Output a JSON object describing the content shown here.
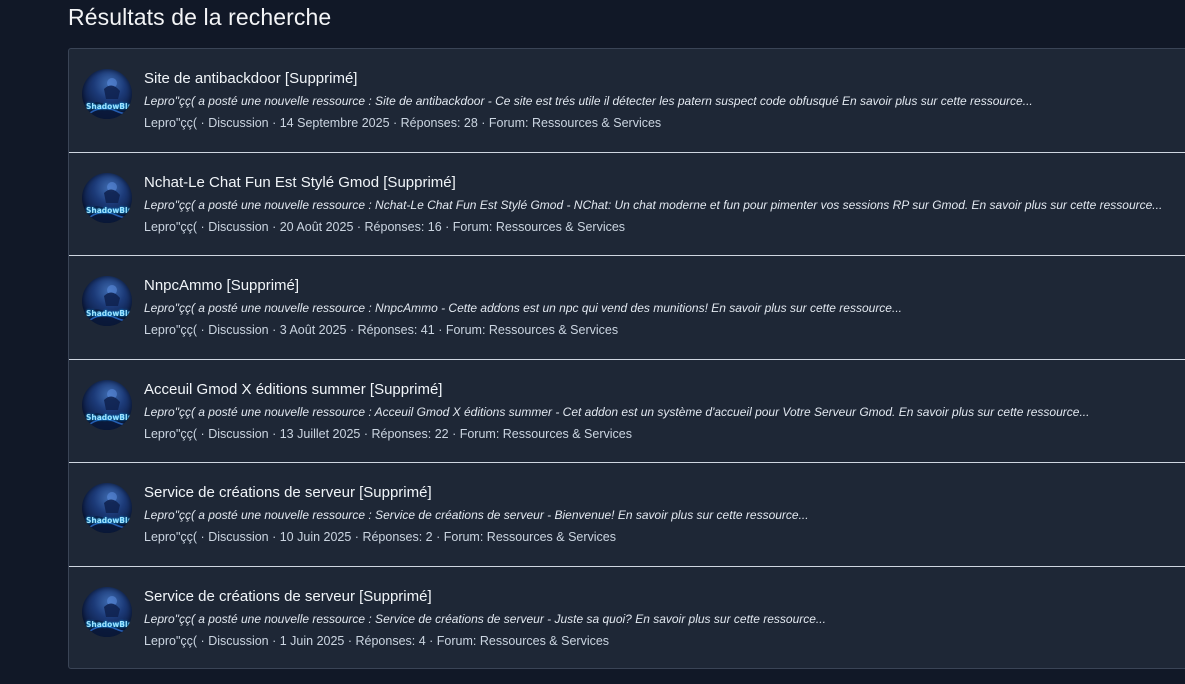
{
  "page": {
    "title": "Résultats de la recherche"
  },
  "results": [
    {
      "title": "Site de antibackdoor [Supprimé]",
      "snippet": "Lepro\"çç( a posté une nouvelle ressource : Site de antibackdoor - Ce site est trés utile il détecter les patern suspect code obfusqué En savoir plus sur cette ressource...",
      "author": "Lepro\"çç(",
      "type": "Discussion",
      "date": "14 Septembre 2025",
      "replies": "Réponses: 28",
      "forum": "Forum: Ressources & Services"
    },
    {
      "title": "Nchat-Le Chat Fun Est Stylé Gmod [Supprimé]",
      "snippet": "Lepro\"çç( a posté une nouvelle ressource : Nchat-Le Chat Fun Est Stylé Gmod - NChat: Un chat moderne et fun pour pimenter vos sessions RP sur Gmod. En savoir plus sur cette ressource...",
      "author": "Lepro\"çç(",
      "type": "Discussion",
      "date": "20 Août 2025",
      "replies": "Réponses: 16",
      "forum": "Forum: Ressources & Services"
    },
    {
      "title": "NnpcAmmo [Supprimé]",
      "snippet": "Lepro\"çç( a posté une nouvelle ressource : NnpcAmmo - Cette addons est un npc qui vend des munitions! En savoir plus sur cette ressource...",
      "author": "Lepro\"çç(",
      "type": "Discussion",
      "date": "3 Août 2025",
      "replies": "Réponses: 41",
      "forum": "Forum: Ressources & Services"
    },
    {
      "title": "Acceuil Gmod X éditions summer [Supprimé]",
      "snippet": "Lepro\"çç( a posté une nouvelle ressource : Acceuil Gmod X éditions summer - Cet addon est un système d'accueil pour Votre Serveur Gmod. En savoir plus sur cette ressource...",
      "author": "Lepro\"çç(",
      "type": "Discussion",
      "date": "13 Juillet 2025",
      "replies": "Réponses: 22",
      "forum": "Forum: Ressources & Services"
    },
    {
      "title": "Service de créations de serveur [Supprimé]",
      "snippet": "Lepro\"çç( a posté une nouvelle ressource : Service de créations de serveur - Bienvenue! En savoir plus sur cette ressource...",
      "author": "Lepro\"çç(",
      "type": "Discussion",
      "date": "10 Juin 2025",
      "replies": "Réponses: 2",
      "forum": "Forum: Ressources & Services"
    },
    {
      "title": "Service de créations de serveur [Supprimé]",
      "snippet": "Lepro\"çç( a posté une nouvelle ressource : Service de créations de serveur - Juste sa quoi? En savoir plus sur cette ressource...",
      "author": "Lepro\"çç(",
      "type": "Discussion",
      "date": "1 Juin 2025",
      "replies": "Réponses: 4",
      "forum": "Forum: Ressources & Services"
    }
  ],
  "avatar": {
    "text": "ShadowBlaze",
    "icon": "user-avatar-icon"
  },
  "separator": " · ",
  "colors": {
    "background": "#111827",
    "panel": "#1e2736",
    "row_divider": "#cfd6e0",
    "text": "#f1f5f9",
    "avatar_glow": "#9fe3ff"
  }
}
